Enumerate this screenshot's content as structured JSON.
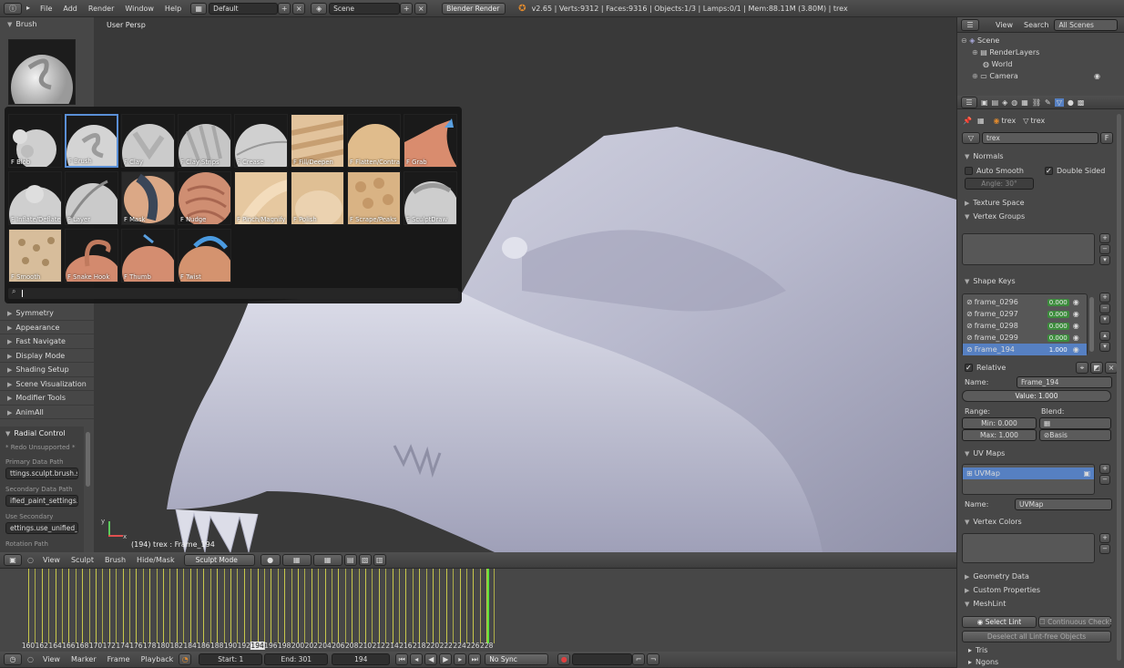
{
  "top_header": {
    "menus": [
      "File",
      "Add",
      "Render",
      "Window",
      "Help"
    ],
    "layout": "Default",
    "scene": "Scene",
    "engine": "Blender Render",
    "stats": "v2.65 | Verts:9312 | Faces:9316 | Objects:1/3 | Lamps:0/1 | Mem:88.11M (3.80M) | trex"
  },
  "tool_shelf": {
    "brush_panel": "Brush",
    "sections": [
      "Symmetry",
      "Appearance",
      "Fast Navigate",
      "Display Mode",
      "Shading Setup",
      "Scene Visualization",
      "Modifier Tools",
      "AnimAll"
    ],
    "radial": {
      "title": "Radial Control",
      "note": "* Redo Unsupported *",
      "primary_label": "Primary Data Path",
      "primary_value": "ttings.sculpt.brush.size",
      "secondary_label": "Secondary Data Path",
      "secondary_value": "ified_paint_settings.size",
      "use_secondary_label": "Use Secondary",
      "use_secondary_value": "ettings.use_unified_size",
      "rotation_label": "Rotation Path"
    }
  },
  "brush_popup": {
    "brushes": [
      "F Blob",
      "F Brush",
      "F Clay",
      "F Clay Strips",
      "F Crease",
      "F Fill/Deepen",
      "F Flatten/Contrast",
      "F Grab",
      "F Inflate/Deflate",
      "F Layer",
      "F Mask",
      "F Nudge",
      "F Pinch/Magnify",
      "F Polish",
      "F Scrape/Peaks",
      "F SculptDraw",
      "F Smooth",
      "F Snake Hook",
      "F Thumb",
      "F Twist"
    ],
    "selected": "F Brush",
    "search_icon": "search-icon"
  },
  "viewport": {
    "label": "User Persp",
    "status": "(194) trex : Frame_194",
    "axis_x": "x",
    "axis_y": "y"
  },
  "viewport_header": {
    "menus": [
      "View",
      "Sculpt",
      "Brush",
      "Hide/Mask"
    ],
    "mode": "Sculpt Mode"
  },
  "timeline": {
    "ticks": [
      "160",
      "162",
      "164",
      "166",
      "168",
      "170",
      "172",
      "174",
      "176",
      "178",
      "180",
      "182",
      "184",
      "186",
      "188",
      "190",
      "192",
      "194",
      "196",
      "198",
      "200",
      "202",
      "204",
      "206",
      "208",
      "210",
      "212",
      "214",
      "216",
      "218",
      "220",
      "222",
      "224",
      "226",
      "228"
    ],
    "current": "194",
    "menus": [
      "View",
      "Marker",
      "Frame",
      "Playback"
    ],
    "start": "Start: 1",
    "end": "End: 301",
    "frame": "194",
    "sync": "No Sync"
  },
  "outliner": {
    "menus": [
      "View",
      "Search"
    ],
    "filter": "All Scenes",
    "items": [
      "Scene",
      "RenderLayers",
      "World",
      "Camera"
    ]
  },
  "properties": {
    "breadcrumb": [
      "trex",
      "trex"
    ],
    "mesh_name": "trex",
    "mesh_f": "F",
    "normals": "Normals",
    "auto_smooth": "Auto Smooth",
    "double_sided": "Double Sided",
    "angle": "Angle: 30°",
    "texture_space": "Texture Space",
    "vertex_groups": "Vertex Groups",
    "shape_keys": "Shape Keys",
    "keys": [
      {
        "name": "frame_0296",
        "value": "0.000"
      },
      {
        "name": "frame_0297",
        "value": "0.000"
      },
      {
        "name": "frame_0298",
        "value": "0.000"
      },
      {
        "name": "frame_0299",
        "value": "0.000"
      },
      {
        "name": "Frame_194",
        "value": "1.000"
      }
    ],
    "relative": "Relative",
    "name_label": "Name:",
    "key_name": "Frame_194",
    "value_field": "Value: 1.000",
    "range_label": "Range:",
    "blend_label": "Blend:",
    "min": "Min: 0.000",
    "max": "Max: 1.000",
    "basis": "Basis",
    "uv_maps": "UV Maps",
    "uv_item": "UVMap",
    "uv_name": "UVMap",
    "vertex_colors": "Vertex Colors",
    "geometry_data": "Geometry Data",
    "custom_properties": "Custom Properties",
    "meshlint": "MeshLint",
    "select_lint": "Select Lint",
    "continuous": "Continuous Check!",
    "deselect": "Deselect all Lint-free Objects",
    "tris": "Tris",
    "ngons": "Ngons"
  },
  "colors": {
    "accent": "#5680c2",
    "timeline_line": "#c8c84b",
    "current_frame": "#5de03a",
    "model": "#c7c8d9"
  }
}
